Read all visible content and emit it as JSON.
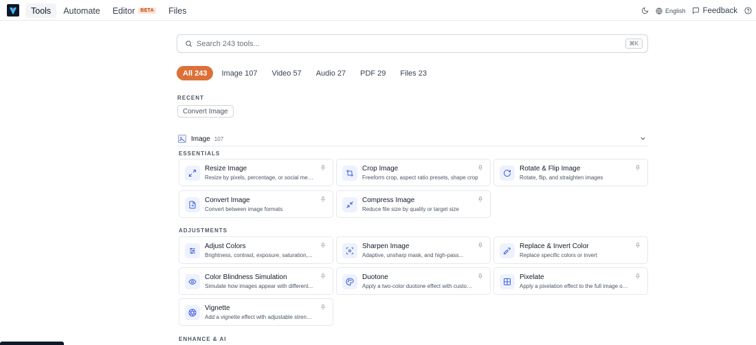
{
  "nav": {
    "items": [
      {
        "label": "Tools"
      },
      {
        "label": "Automate"
      },
      {
        "label": "Editor",
        "badge": "BETA"
      },
      {
        "label": "Files"
      }
    ],
    "language": "English",
    "feedback": "Feedback"
  },
  "search": {
    "placeholder": "Search 243 tools...",
    "shortcut": "⌘K"
  },
  "filters": [
    {
      "label": "All 243"
    },
    {
      "label": "Image 107"
    },
    {
      "label": "Video 57"
    },
    {
      "label": "Audio 27"
    },
    {
      "label": "PDF 29"
    },
    {
      "label": "Files 23"
    }
  ],
  "recent": {
    "label": "RECENT",
    "items": [
      "Convert Image"
    ]
  },
  "category": {
    "title": "Image",
    "count": "107"
  },
  "groups": {
    "essentials": "ESSENTIALS",
    "adjustments": "ADJUSTMENTS",
    "enhance": "ENHANCE & AI"
  },
  "tools": {
    "resize": {
      "title": "Resize Image",
      "desc": "Resize by pixels, percentage, or social media..."
    },
    "crop": {
      "title": "Crop Image",
      "desc": "Freeform crop, aspect ratio presets, shape crop"
    },
    "rotate": {
      "title": "Rotate & Flip Image",
      "desc": "Rotate, flip, and straighten images"
    },
    "convert": {
      "title": "Convert Image",
      "desc": "Convert between image formats"
    },
    "compress": {
      "title": "Compress Image",
      "desc": "Reduce file size by quality or target size"
    },
    "adjust": {
      "title": "Adjust Colors",
      "desc": "Brightness, contrast, exposure, saturation,..."
    },
    "sharpen": {
      "title": "Sharpen Image",
      "desc": "Adaptive, unsharp mask, and high-pass..."
    },
    "replace": {
      "title": "Replace & Invert Color",
      "desc": "Replace specific colors or invert"
    },
    "colorblind": {
      "title": "Color Blindness Simulation",
      "desc": "Simulate how images appear with different..."
    },
    "duotone": {
      "title": "Duotone",
      "desc": "Apply a two-color duotone effect with custom..."
    },
    "pixelate": {
      "title": "Pixelate",
      "desc": "Apply a pixelation effect to the full image or a..."
    },
    "vignette": {
      "title": "Vignette",
      "desc": "Add a vignette effect with adjustable strength..."
    }
  },
  "colors": {
    "accent": "#dc7037",
    "icon": "#3b5bdb"
  }
}
